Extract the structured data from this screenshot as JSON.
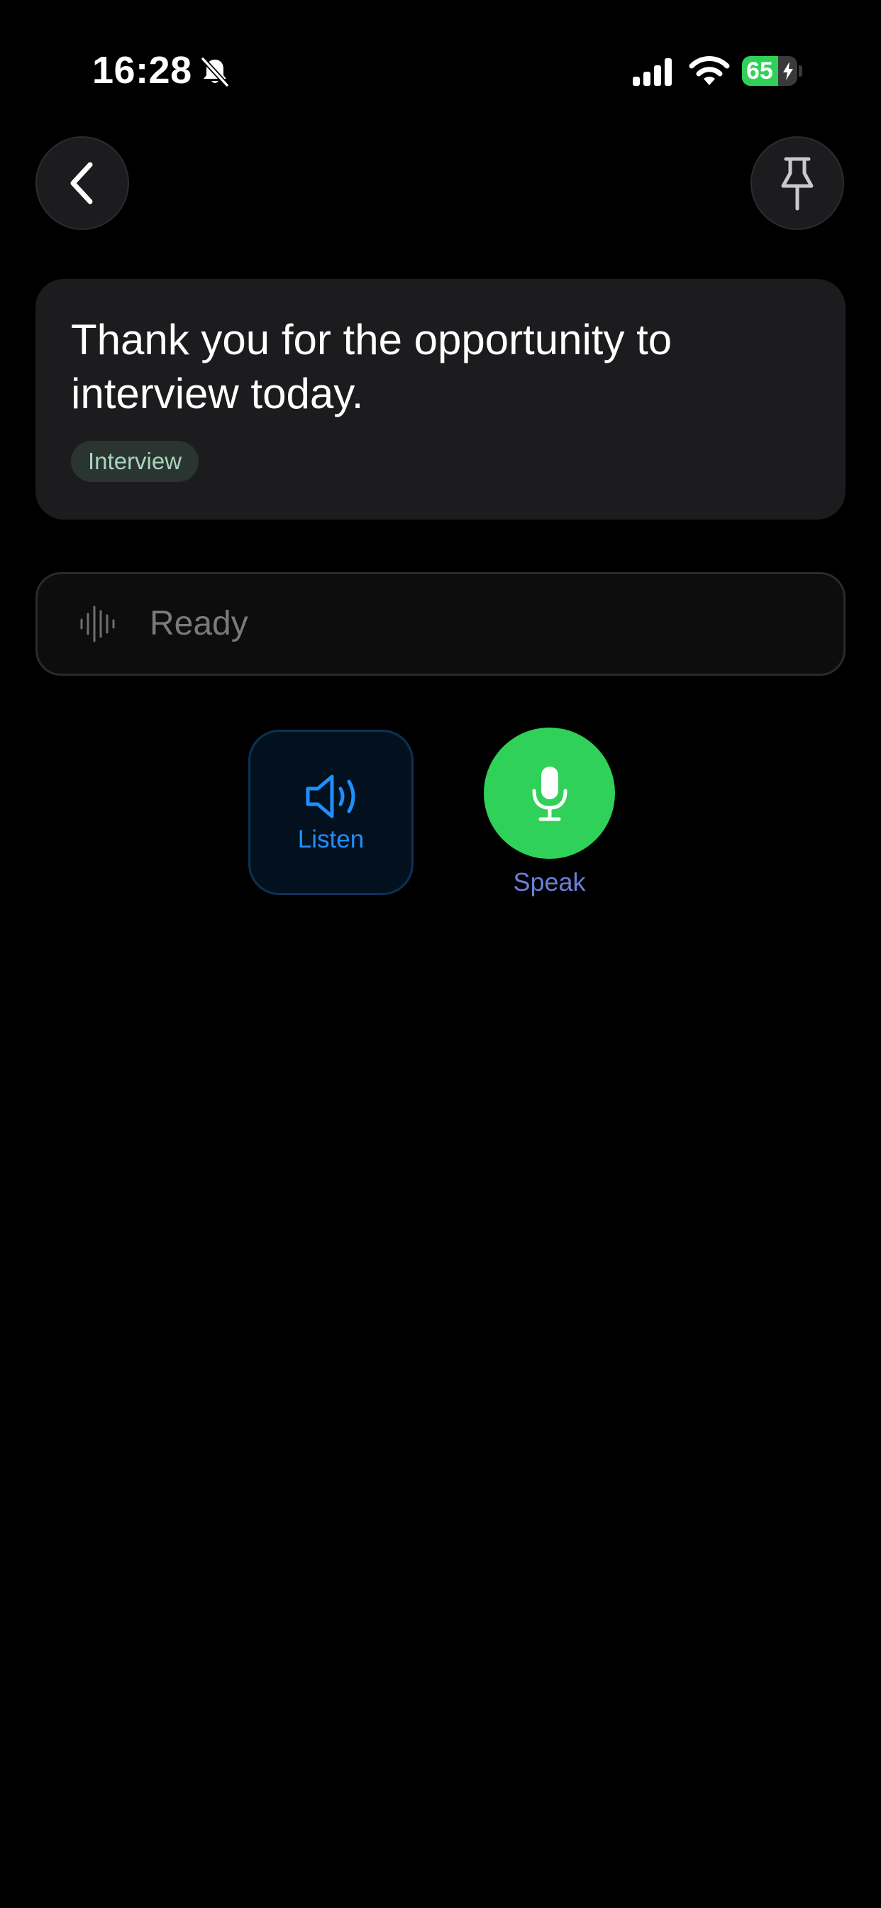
{
  "status_bar": {
    "time": "16:28",
    "battery_level": "65",
    "battery_fraction": 0.65,
    "icons": [
      "bell-slash-icon",
      "cellular-signal-icon",
      "wifi-icon",
      "battery-charging-icon"
    ]
  },
  "header": {
    "back_icon": "chevron-left-icon",
    "pin_icon": "pin-icon"
  },
  "phrase": {
    "text": "Thank you for the opportunity to interview today.",
    "tag": "Interview"
  },
  "recognition": {
    "icon": "waveform-icon",
    "status": "Ready"
  },
  "actions": {
    "listen_label": "Listen",
    "listen_icon": "speaker-wave-icon",
    "speak_label": "Speak",
    "speak_icon": "microphone-icon"
  },
  "colors": {
    "background": "#000000",
    "card": "#1c1c1e",
    "accent_green": "#30d158",
    "accent_blue": "#1e8fff",
    "speak_label": "#6c7fd6",
    "tag_text": "#a8d5bd"
  }
}
